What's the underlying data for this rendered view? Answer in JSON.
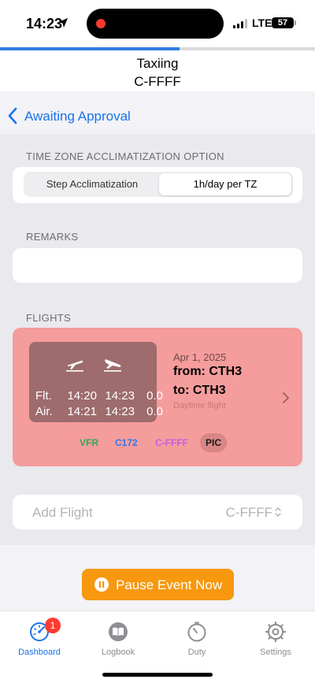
{
  "status_bar": {
    "time": "14:23",
    "network": "LTE",
    "battery": "57"
  },
  "header": {
    "title": "Taxiing",
    "subtitle": "C-FFFF",
    "progress": 0.57
  },
  "nav": {
    "back_label": "Awaiting Approval"
  },
  "timezone_section": {
    "label": "TIME ZONE ACCLIMATIZATION OPTION",
    "options": [
      "Step Acclimatization",
      "1h/day per TZ"
    ],
    "selected": "1h/day per TZ"
  },
  "remarks_section": {
    "label": "REMARKS",
    "value": ""
  },
  "flights_section": {
    "label": "FLIGHTS",
    "flights": [
      {
        "flt_label": "Flt.",
        "flt_dep": "14:20",
        "flt_arr": "14:23",
        "flt_dur": "0.0",
        "air_label": "Air.",
        "air_dep": "14:21",
        "air_arr": "14:23",
        "air_dur": "0.0",
        "date": "Apr 1, 2025",
        "from": "from: CTH3",
        "to": "to: CTH3",
        "period": "Daytime flight",
        "tags": {
          "rules": "VFR",
          "aircraft": "C172",
          "registration": "C-FFFF",
          "role": "PIC"
        }
      }
    ]
  },
  "add_flight": {
    "placeholder": "Add Flight",
    "aircraft": "C-FFFF"
  },
  "pause_button": {
    "label": "Pause Event Now"
  },
  "tabbar": {
    "tabs": [
      {
        "label": "Dashboard",
        "icon": "gauge-icon",
        "badge": "1",
        "active": true
      },
      {
        "label": "Logbook",
        "icon": "book-icon"
      },
      {
        "label": "Duty",
        "icon": "stopwatch-icon"
      },
      {
        "label": "Settings",
        "icon": "gear-icon"
      }
    ]
  },
  "colors": {
    "accent": "#1a73e8",
    "flight_card": "#f59c9c",
    "pause_button": "#f7980f",
    "vfr": "#3aa654",
    "aircraft": "#2c7ae8",
    "registration": "#c45fe4"
  }
}
